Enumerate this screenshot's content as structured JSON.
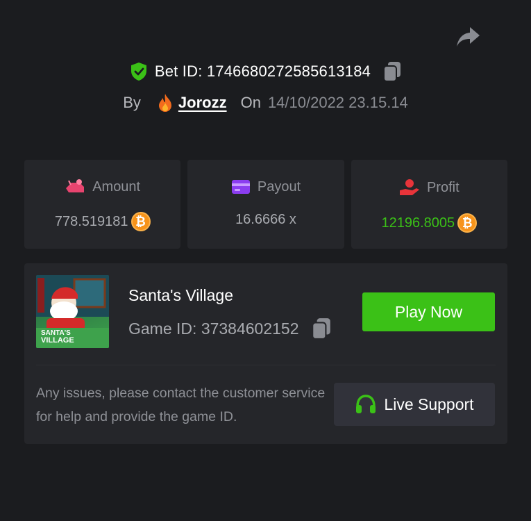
{
  "header": {
    "bet_id_label": "Bet ID:",
    "bet_id": "1746680272585613184",
    "by_label": "By",
    "user_name": "Jorozz",
    "on_label": "On",
    "date": "14/10/2022 23.15.14"
  },
  "stats": {
    "amount_label": "Amount",
    "amount_value": "778.519181",
    "payout_label": "Payout",
    "payout_value": "16.6666 x",
    "profit_label": "Profit",
    "profit_value": "12196.8005"
  },
  "game": {
    "title": "Santa's Village",
    "game_id_label": "Game ID:",
    "game_id": "37384602152",
    "play_label": "Play Now",
    "thumb_text_1": "SANTA'S",
    "thumb_text_2": "VILLAGE"
  },
  "support": {
    "message": "Any issues, please contact the customer service for help and provide the game ID.",
    "button_label": "Live Support"
  },
  "colors": {
    "accent_green": "#3bc117",
    "background": "#1b1c1f",
    "card": "#25262a",
    "coin": "#f7931a"
  },
  "icons": [
    "share-icon",
    "shield-check-icon",
    "copy-icon",
    "fire-icon",
    "bet-amount-icon",
    "card-icon",
    "profit-hand-icon",
    "bitcoin-icon",
    "headset-icon"
  ]
}
